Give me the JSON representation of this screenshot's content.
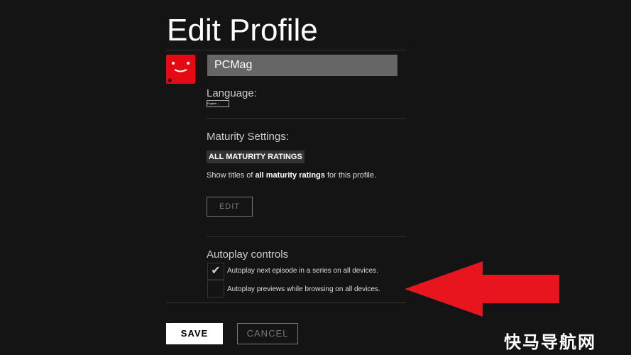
{
  "title": "Edit Profile",
  "profile": {
    "name": "PCMag",
    "avatar_icon": "smiley-face-icon",
    "avatar_color": "#e50914"
  },
  "language": {
    "label": "Language:",
    "value": "English"
  },
  "maturity": {
    "label": "Maturity Settings:",
    "badge": "ALL MATURITY RATINGS",
    "desc_pre": "Show titles of ",
    "desc_bold": "all maturity ratings",
    "desc_post": " for this profile.",
    "edit": "EDIT"
  },
  "autoplay": {
    "label": "Autoplay controls",
    "items": [
      {
        "label": "Autoplay next episode in a series on all devices.",
        "checked": true
      },
      {
        "label": "Autoplay previews while browsing on all devices.",
        "checked": false
      }
    ]
  },
  "actions": {
    "save": "SAVE",
    "cancel": "CANCEL"
  },
  "watermark": "快马导航网",
  "arrow_color": "#e8141e"
}
